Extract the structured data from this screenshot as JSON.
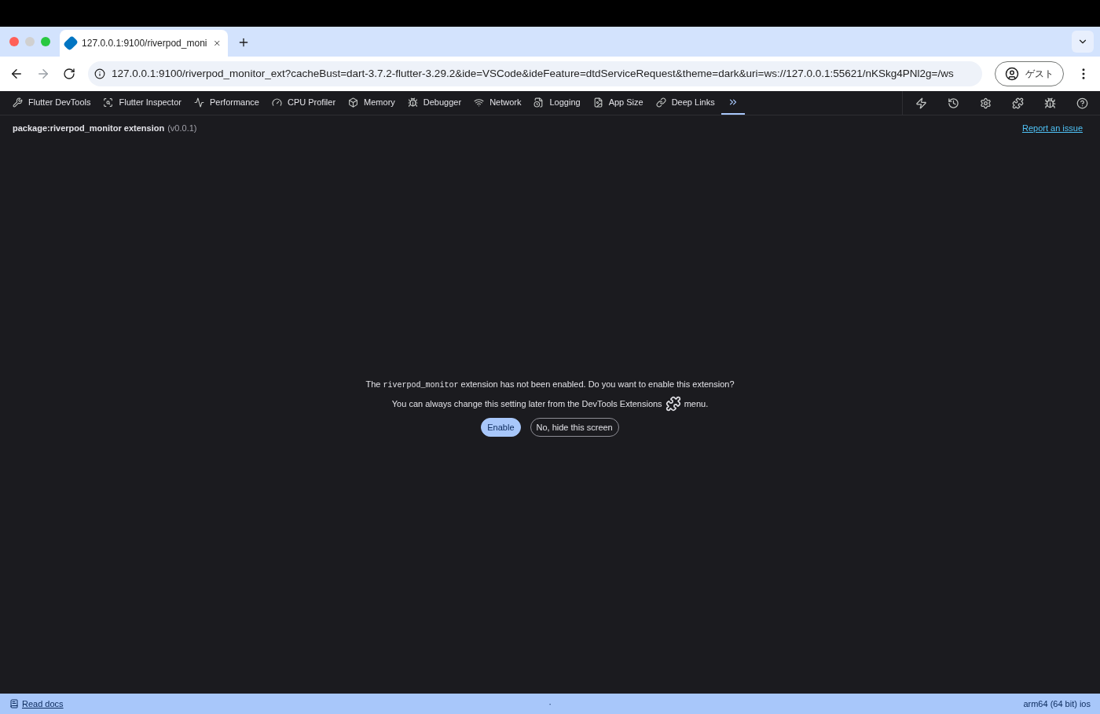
{
  "browser": {
    "tab": {
      "title": "127.0.0.1:9100/riverpod_moni",
      "selected": true
    },
    "url": "127.0.0.1:9100/riverpod_monitor_ext?cacheBust=dart-3.7.2-flutter-3.29.2&ide=VSCode&ideFeature=dtdServiceRequest&theme=dark&uri=ws://127.0.0.1:55621/nKSkg4PNl2g=/ws",
    "profile": "ゲスト"
  },
  "nav": {
    "items": [
      {
        "label": "Flutter DevTools",
        "selected": false
      },
      {
        "label": "Flutter Inspector",
        "selected": false
      },
      {
        "label": "Performance",
        "selected": false
      },
      {
        "label": "CPU Profiler",
        "selected": false
      },
      {
        "label": "Memory",
        "selected": false
      },
      {
        "label": "Debugger",
        "selected": false
      },
      {
        "label": "Network",
        "selected": false
      },
      {
        "label": "Logging",
        "selected": false
      },
      {
        "label": "App Size",
        "selected": false
      },
      {
        "label": "Deep Links",
        "selected": false
      }
    ],
    "more_selected": true
  },
  "header": {
    "package": "package:riverpod_monitor extension",
    "version": "(v0.0.1)",
    "report_link": "Report an issue"
  },
  "prompt": {
    "line1_before": "The ",
    "line1_code": "riverpod_monitor",
    "line1_after": " extension has not been enabled. Do you want to enable this extension?",
    "line2_before": "You can always change this setting later from the DevTools Extensions",
    "line2_after": "menu.",
    "buttons": [
      "Enable",
      "No, hide this screen"
    ]
  },
  "status_bar": {
    "docs_link": "Read docs",
    "dot": "·",
    "device": "arm64 (64 bit) ios"
  }
}
